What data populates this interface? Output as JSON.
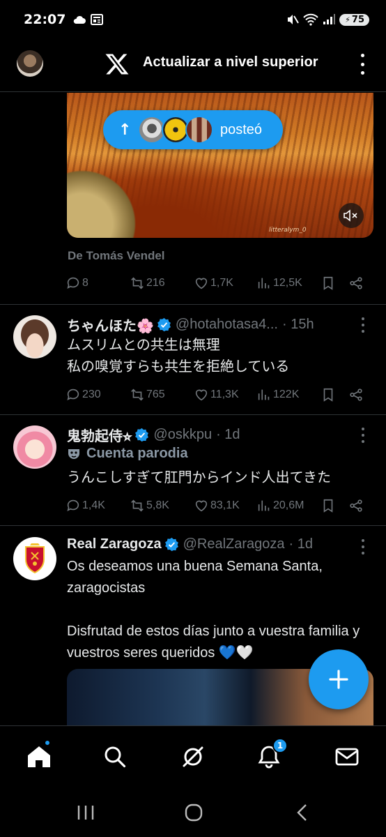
{
  "status_bar": {
    "time": "22:07",
    "battery": "75",
    "icons": [
      "cloud-icon",
      "news-icon",
      "mute-icon",
      "wifi-icon",
      "signal-icon",
      "battery-icon"
    ]
  },
  "app_bar": {
    "title": "Actualizar a nivel superior",
    "logo": "x-logo-icon"
  },
  "posted_pill": {
    "label": "posteó"
  },
  "first_post": {
    "media_watermark": "litteralym_0",
    "from_label": "De Tomás Vendel",
    "stats": {
      "replies": "8",
      "reposts": "216",
      "likes": "1,7K",
      "views": "12,5K"
    }
  },
  "tweets": [
    {
      "name": "ちゃんほた🌸",
      "handle": "@hotahotasa4...",
      "time": "· 15h",
      "body": "ムスリムとの共生は無理\n私の嗅覚すらも共生を拒絶している",
      "stats": {
        "replies": "230",
        "reposts": "765",
        "likes": "11,3K",
        "views": "122K"
      }
    },
    {
      "name": "鬼勃起侍⭐︎",
      "handle": "@oskkpu",
      "time": "· 1d",
      "parody_label": "Cuenta parodia",
      "body": "うんこしすぎて肛門からインド人出てきた",
      "stats": {
        "replies": "1,4K",
        "reposts": "5,8K",
        "likes": "83,1K",
        "views": "20,6M"
      }
    },
    {
      "name": "Real Zaragoza",
      "handle": "@RealZaragoza",
      "time": "· 1d",
      "body": "Os deseamos una buena Semana Santa, zaragocistas\n\nDisfrutad de estos días junto a vuestra familia y vuestros seres queridos 💙🤍"
    }
  ],
  "bottom_nav": {
    "items": [
      "home-icon",
      "search-icon",
      "grok-icon",
      "notifications-icon",
      "messages-icon"
    ],
    "notifications_badge": "1"
  },
  "colors": {
    "accent": "#1d9bf0",
    "background": "#000000",
    "text": "#e7e9ea",
    "muted": "#71767b"
  }
}
